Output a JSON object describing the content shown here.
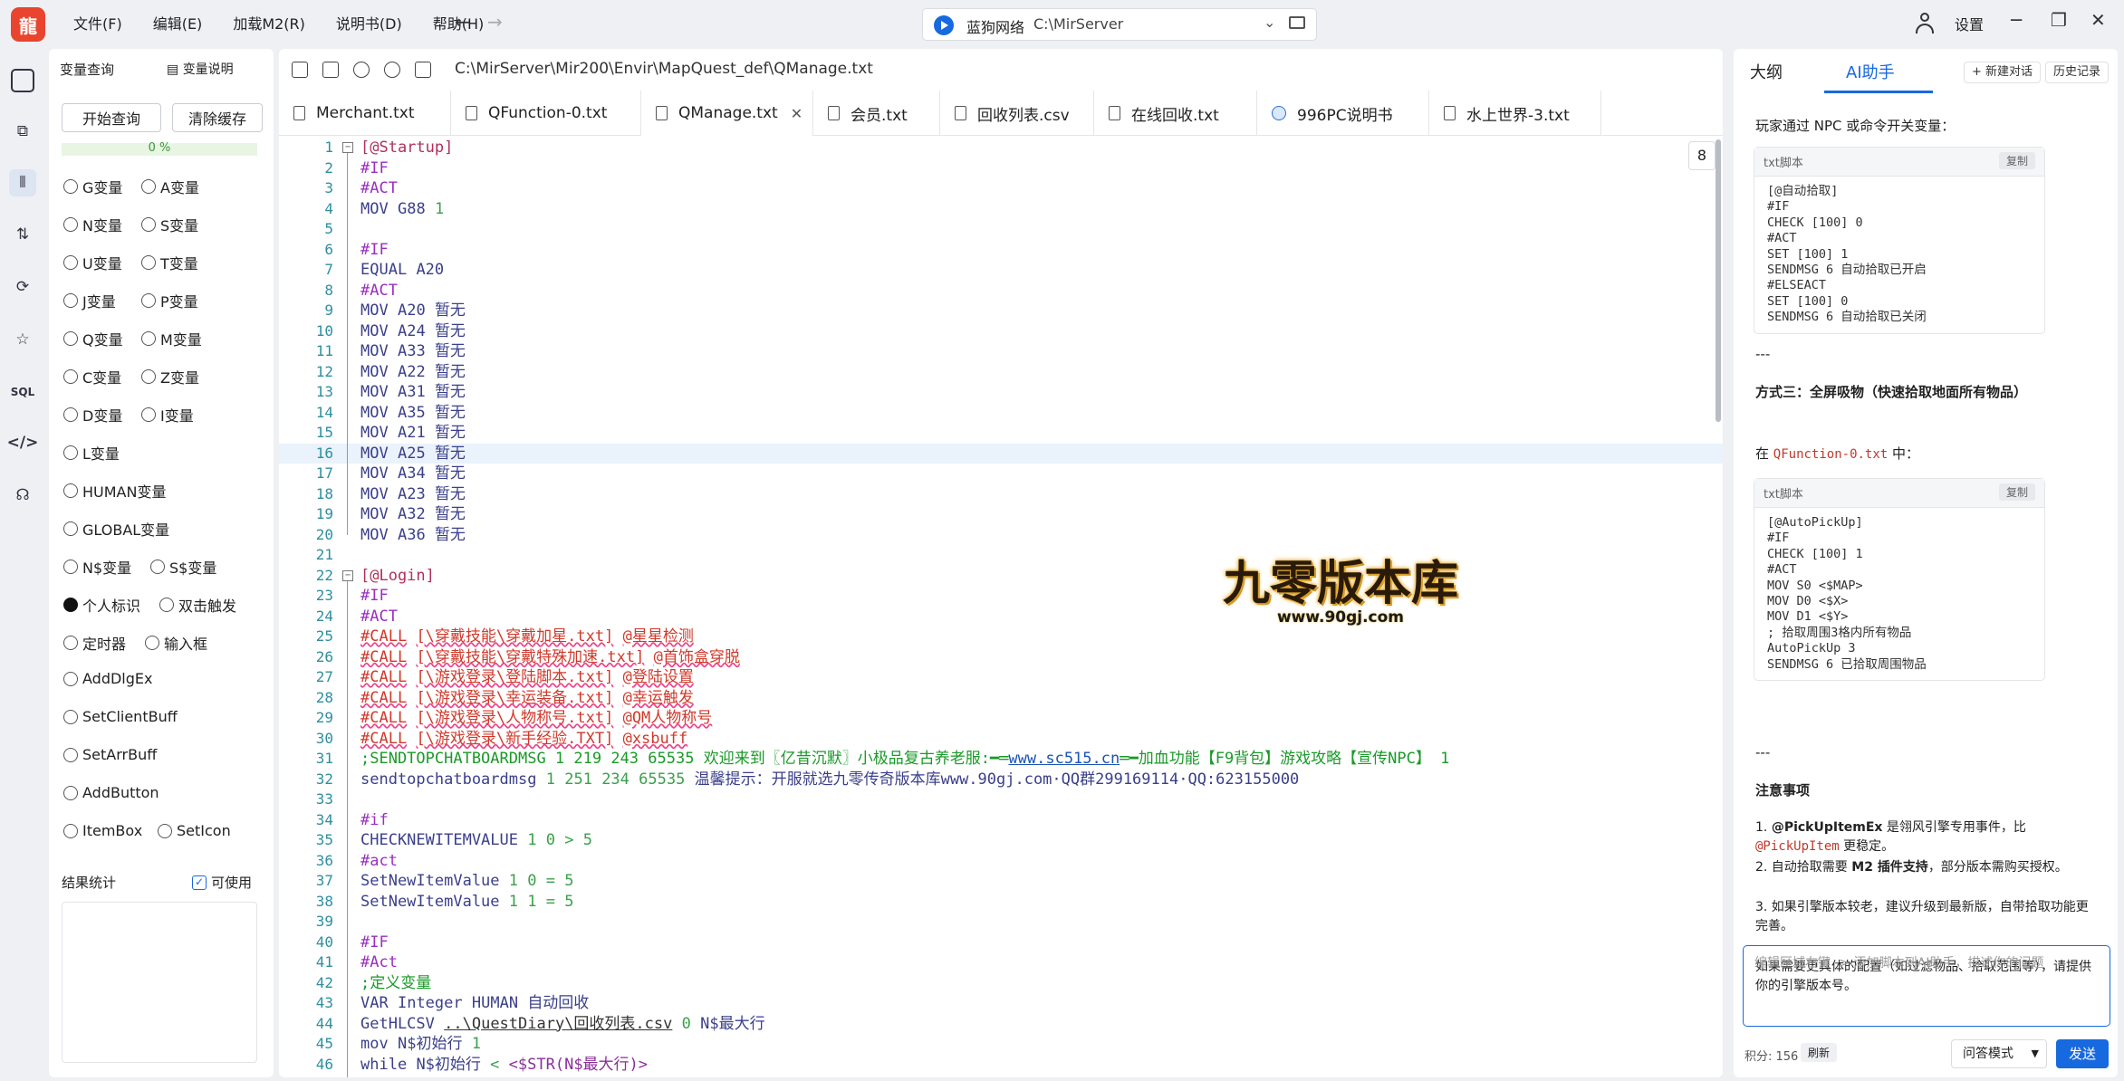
{
  "menu": [
    "文件(F)",
    "编辑(E)",
    "加载M2(R)",
    "说明书(D)",
    "帮助(H)"
  ],
  "logo_char": "龍",
  "server": {
    "name": "蓝狗网络",
    "path": "C:\\MirServer"
  },
  "top_right": {
    "settings": "设置"
  },
  "var_panel": {
    "title": "变量查询",
    "help": "变量说明",
    "start_btn": "开始查询",
    "clear_btn": "清除缓存",
    "progress_pct": "0 %",
    "progress_value": 0,
    "result_label": "结果统计",
    "usable_label": "可使用",
    "radios": [
      [
        "G变量",
        "A变量"
      ],
      [
        "N变量",
        "S变量"
      ],
      [
        "U变量",
        "T变量"
      ],
      [
        "J变量",
        "P变量"
      ],
      [
        "Q变量",
        "M变量"
      ],
      [
        "C变量",
        "Z变量"
      ],
      [
        "D变量",
        "I变量"
      ],
      [
        "L变量"
      ],
      [
        "HUMAN变量"
      ],
      [
        "GLOBAL变量"
      ],
      [
        "N$变量",
        "S$变量"
      ],
      [
        "个人标识",
        "双击触发"
      ],
      [
        "定时器",
        "输入框"
      ],
      [
        "AddDlgEx"
      ],
      [
        "SetClientBuff"
      ],
      [
        "SetArrBuff"
      ],
      [
        "AddButton"
      ],
      [
        "ItemBox",
        "SetIcon"
      ]
    ]
  },
  "editor": {
    "path": "C:\\MirServer\\Mir200\\Envir\\MapQuest_def\\QManage.txt",
    "tabs": [
      "Merchant.txt",
      "QFunction-0.txt",
      "QManage.txt",
      "会员.txt",
      "回收列表.csv",
      "在线回收.txt",
      "996PC说明书",
      "水上世界-3.txt"
    ],
    "active_tab": "QManage.txt",
    "tab_count": "8",
    "watermark_big": "九零版本库",
    "watermark_small": "www.90gj.com",
    "lines": [
      "[@Startup]",
      "#IF",
      "#ACT",
      "MOV G88 1",
      "",
      "#IF",
      "EQUAL A20",
      "#ACT",
      "MOV A20 暂无",
      "MOV A24 暂无",
      "MOV A33 暂无",
      "MOV A22 暂无",
      "MOV A31 暂无",
      "MOV A35 暂无",
      "MOV A21 暂无",
      "MOV A25 暂无",
      "MOV A34 暂无",
      "MOV A23 暂无",
      "MOV A32 暂无",
      "MOV A36 暂无",
      "",
      "[@Login]",
      "#IF",
      "#ACT",
      "#CALL [\\穿戴技能\\穿戴加星.txt] @星星检测",
      "#CALL [\\穿戴技能\\穿戴特殊加速.txt] @首饰盒穿脱",
      "#CALL [\\游戏登录\\登陆脚本.txt] @登陆设置",
      "#CALL [\\游戏登录\\幸运装备.txt] @幸运触发",
      "#CALL [\\游戏登录\\人物称号.txt] @QM人物称号",
      "#CALL [\\游戏登录\\新手经验.TXT] @xsbuff",
      ";SENDTOPCHATBOARDMSG 1 219 243 65535 欢迎来到〖亿昔沉默〗小极品复古养老服:━═www.sc515.cn═━加血功能【F9背包】游戏攻略【宣传NPC】 1",
      "sendtopchatboardmsg 1 251 234 65535 温馨提示：开服就选九零传奇版本库www.90gj.com·QQ群299169114·QQ:623155000",
      "",
      "#if",
      "CHECKNEWITEMVALUE 1 0 > 5",
      "#act",
      "SetNewItemValue 1 0 = 5",
      "SetNewItemValue 1 1 = 5",
      "",
      "#IF",
      "#Act",
      ";定义变量",
      "VAR Integer HUMAN 自动回收",
      "GetHLCSV ..\\QuestDiary\\回收列表.csv 0 N$最大行",
      "mov N$初始行 1",
      "while N$初始行 < <$STR(N$最大行)>"
    ]
  },
  "ai": {
    "tab_outline": "大纲",
    "tab_ai": "AI助手",
    "new_chat": "+ 新建对话",
    "history": "历史记录",
    "intro1": "玩家通过 NPC 或命令开关变量：",
    "code_label": "txt脚本",
    "copy": "复制",
    "code1": "[@自动拾取]\n#IF\nCHECK [100] 0\n#ACT\nSET [100] 1\nSENDMSG 6 自动拾取已开启\n#ELSEACT\nSET [100] 0\nSENDMSG 6 自动拾取已关闭",
    "sep": "---",
    "method3": "方式三：全屏吸物（快速拾取地面所有物品）",
    "in_prefix": "在 ",
    "in_file": "QFunction-0.txt",
    "in_suffix": " 中：",
    "code2": "[@AutoPickUp]\n#IF\nCHECK [100] 1\n#ACT\nMOV S0 <$MAP>\nMOV D0 <$X>\nMOV D1 <$Y>\n; 拾取周围3格内所有物品\nAutoPickUp 3\nSENDMSG 6 已拾取周围物品",
    "notes_title": "注意事项",
    "note1a": "1. ",
    "note1b": "@PickUpItemEx",
    "note1c": " 是翎风引擎专用事件，比",
    "note1d": "@PickUpItem",
    "note1e": " 更稳定。",
    "note2a": "2. 自动拾取需要 ",
    "note2b": "M2 插件支持",
    "note2c": "，部分版本需购买授权。",
    "note3": "3. 如果引擎版本较老，建议升级到最新版，自带拾取功能更完善。",
    "tail": "如果需要更具体的配置（如过滤物品、拾取范围等），请提供你的引擎版本号。",
    "input_placeholder": "编辑区域右键 -> 添加脚本到AI助手，描述你的问题",
    "score": "积分: 156",
    "refresh": "刷新",
    "mode": "问答模式",
    "send": "发送"
  }
}
